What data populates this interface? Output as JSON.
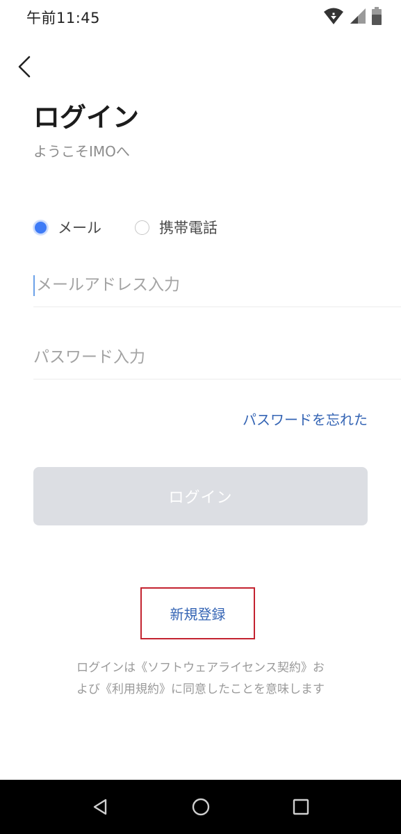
{
  "status_bar": {
    "time": "午前11:45",
    "icons": [
      "wifi-icon",
      "signal-icon",
      "battery-icon"
    ]
  },
  "header": {
    "back_icon": "chevron-left-icon",
    "title": "ログイン",
    "subtitle": "ようこそIMOへ"
  },
  "login_type": {
    "options": [
      {
        "label": "メール",
        "selected": true
      },
      {
        "label": "携帯電話",
        "selected": false
      }
    ]
  },
  "form": {
    "email": {
      "placeholder": "メールアドレス入力",
      "value": ""
    },
    "password": {
      "placeholder": "パスワード入力",
      "value": ""
    },
    "forgot_password": "パスワードを忘れた",
    "login_button": "ログイン",
    "register_link": "新規登録"
  },
  "legal": {
    "text": "ログインは《ソフトウェアライセンス契約》および《利用規約》に同意したことを意味します"
  },
  "colors": {
    "accent": "#3464b4",
    "radio_selected": "#3e7bf6",
    "button_disabled": "#dcdee3",
    "highlight_box": "#c3222f"
  },
  "nav_bar": {
    "icons": [
      "back-triangle-icon",
      "home-circle-icon",
      "recents-square-icon"
    ]
  }
}
